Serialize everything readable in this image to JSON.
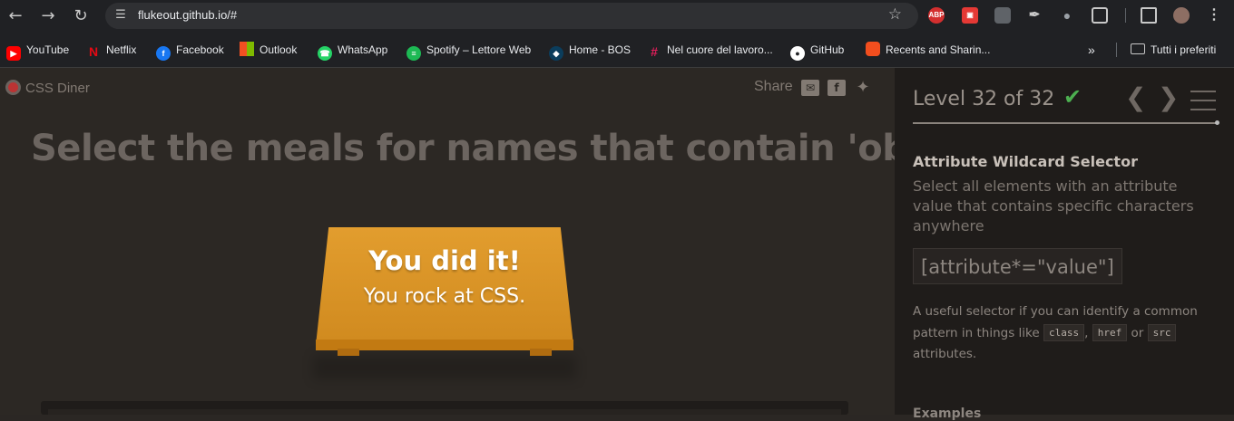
{
  "browser": {
    "url": "flukeout.github.io/#",
    "bookmarks": [
      {
        "label": "YouTube",
        "icon": "youtube-icon",
        "color": "#ff0000"
      },
      {
        "label": "Netflix",
        "icon": "netflix-icon",
        "color": "#e50914"
      },
      {
        "label": "Facebook",
        "icon": "facebook-icon",
        "color": "#1877f2"
      },
      {
        "label": "Outlook",
        "icon": "outlook-icon",
        "color": "#0078d4"
      },
      {
        "label": "WhatsApp",
        "icon": "whatsapp-icon",
        "color": "#25d366"
      },
      {
        "label": "Spotify – Lettore Web",
        "icon": "spotify-icon",
        "color": "#1db954"
      },
      {
        "label": "Home - BOS",
        "icon": "bos-icon",
        "color": "#0b3d5c"
      },
      {
        "label": "Nel cuore del lavoro...",
        "icon": "slack-icon",
        "color": "#4a154b"
      },
      {
        "label": "GitHub",
        "icon": "github-icon",
        "color": "#ffffff"
      },
      {
        "label": "Recents and Sharin...",
        "icon": "figma-icon",
        "color": "#f24e1e"
      }
    ],
    "all_bookmarks_label": "Tutti i preferiti",
    "extensions": {
      "abp_label": "ABP"
    }
  },
  "game": {
    "logo": "CSS Diner",
    "share_label": "Share",
    "heading": "Select the meals for names that contain 'obb'",
    "win_title": "You did it!",
    "win_subtitle": "You rock at CSS."
  },
  "sidebar": {
    "level_text": "Level 32 of 32",
    "progress_fraction": 1.0,
    "selector_name": "Attribute Wildcard Selector",
    "selector_description": "Select all elements with an attribute value that contains specific characters anywhere",
    "syntax": "[attribute*=\"value\"]",
    "hint_text_1": "A useful selector if you can identify a common pattern in things like",
    "hint_code_1": "class",
    "hint_sep": ",",
    "hint_code_2": "href",
    "hint_or": "or",
    "hint_code_3": "src",
    "hint_text_2": "attributes.",
    "examples_label": "Examples"
  },
  "colors": {
    "accent_check": "#4caf50",
    "table": "#e29d2e"
  }
}
